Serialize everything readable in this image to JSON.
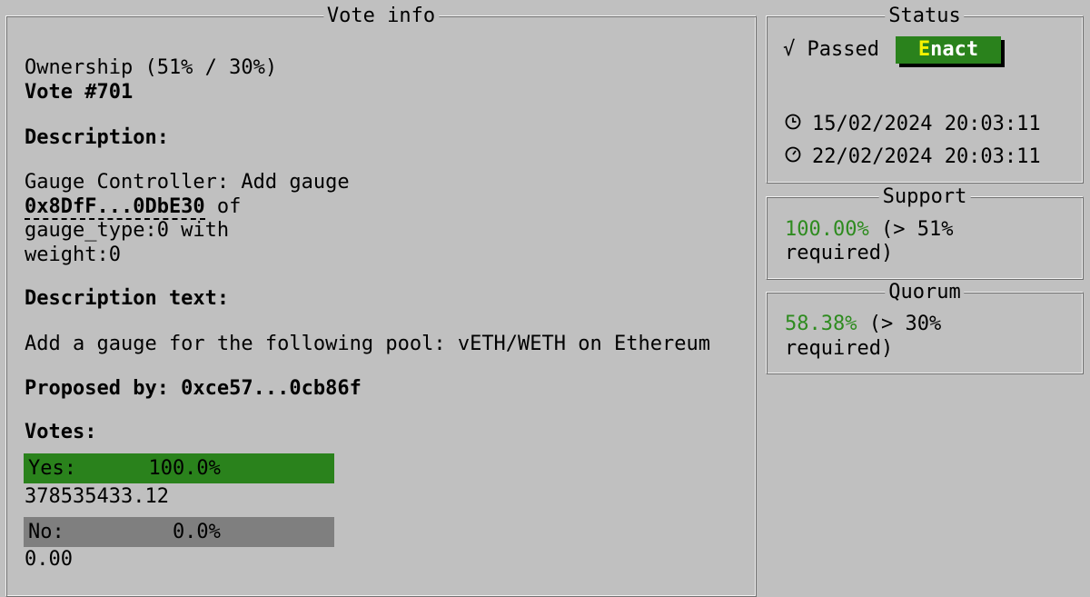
{
  "vote_info": {
    "title": "Vote info",
    "ownership": "Ownership (51% / 30%)",
    "vote_number": "Vote #701",
    "description_label": "Description:",
    "description_line1": "Gauge Controller: Add gauge",
    "gauge_address": "0x8DfF...0DbE30",
    "gauge_suffix": " of",
    "description_line3": "gauge_type:0 with",
    "description_line4": "weight:0",
    "description_text_label": "Description text:",
    "description_text": "Add a gauge for the following pool: vETH/WETH on Ethereum",
    "proposed_by": "Proposed by: 0xce57...0cb86f",
    "votes_label": "Votes:",
    "yes_label": "Yes:      100.0%",
    "yes_amount": "378535433.12",
    "yes_fraction": 1.0,
    "no_label": "No:         0.0%",
    "no_amount": "0.00",
    "no_fraction": 0.0
  },
  "status": {
    "title": "Status",
    "check_glyph": "√",
    "state": "Passed",
    "enact_hotkey": "E",
    "enact_rest": "nact",
    "start_icon": "clock-icon",
    "start_time": "15/02/2024 20:03:11",
    "end_icon": "timer-icon",
    "end_time": "22/02/2024 20:03:11"
  },
  "support": {
    "title": "Support",
    "value": "100.00%",
    "requirement_1": " (> 51%",
    "requirement_2": "required)"
  },
  "quorum": {
    "title": "Quorum",
    "value": "58.38%",
    "requirement_1": " (> 30%",
    "requirement_2": "required)"
  },
  "colors": {
    "background": "#c0c0c0",
    "accent_green": "#2a821c",
    "value_green": "#2e8b1f",
    "no_bar": "#7f7f7f",
    "hotkey_yellow": "#f6f200"
  }
}
